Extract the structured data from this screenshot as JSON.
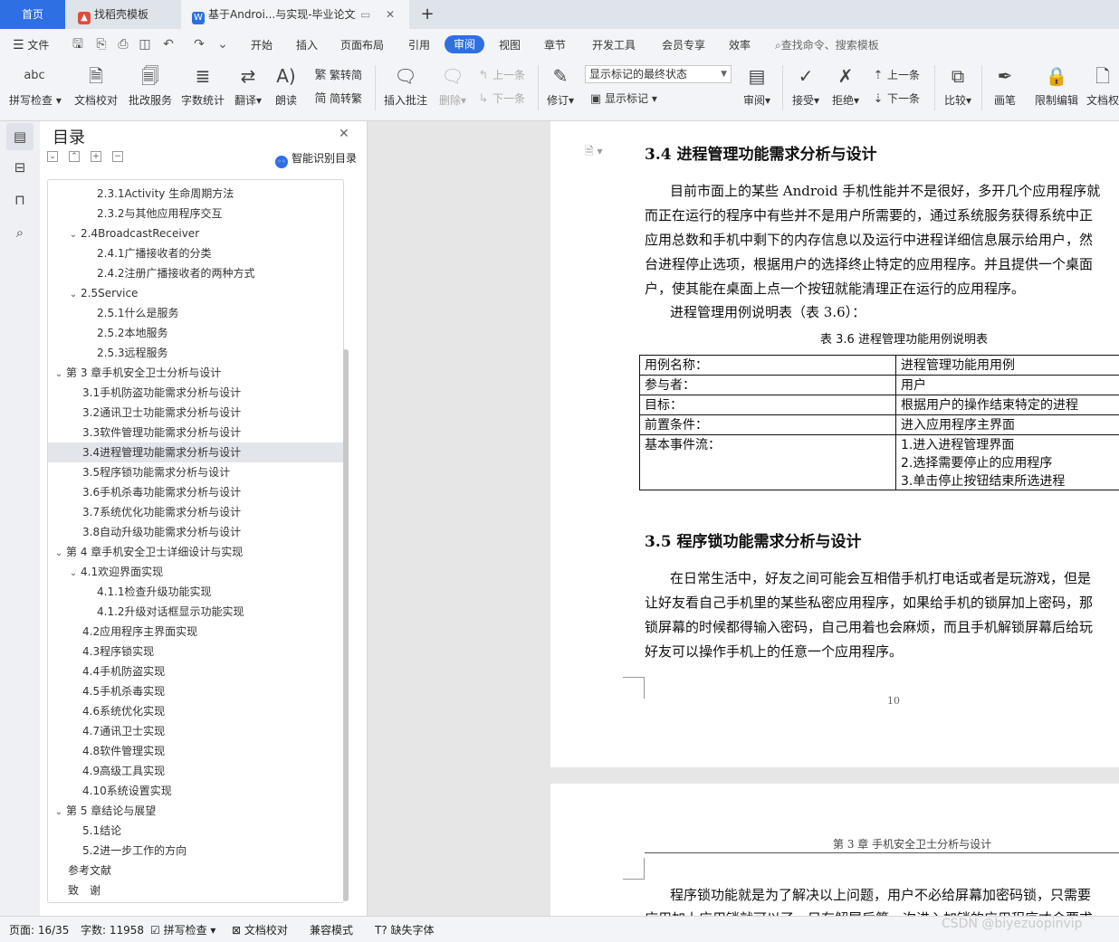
{
  "tabs": {
    "home": "首页",
    "templates": "找稻壳模板",
    "document": "基于Androi...与实现-毕业论文",
    "new_tab_icon": "plus-icon"
  },
  "menubar": {
    "file": "文件",
    "items": [
      "开始",
      "插入",
      "页面布局",
      "引用",
      "审阅",
      "视图",
      "章节",
      "开发工具",
      "会员专享",
      "效率"
    ],
    "active": "审阅",
    "search": "查找命令、搜索模板"
  },
  "ribbon": {
    "spellcheck": "拼写检查",
    "spellcheck_glyph": "abc",
    "doc_proof": "文档校对",
    "batch_service": "批改服务",
    "word_count": "字数统计",
    "translate": "翻译",
    "read_aloud": "朗读",
    "to_simplified": "繁转简",
    "to_traditional": "简转繁",
    "insert_comment": "插入批注",
    "delete": "删除",
    "prev": "上一条",
    "next": "下一条",
    "revise": "修订",
    "markup_state": "显示标记的最终状态",
    "show_markup": "显示标记",
    "review": "审阅",
    "accept": "接受",
    "reject": "拒绝",
    "prev2": "上一条",
    "next2": "下一条",
    "compare": "比较",
    "pen": "画笔",
    "restrict_edit": "限制编辑",
    "doc_rights": "文档权"
  },
  "toc": {
    "title": "目录",
    "smart": "智能识别目录",
    "selected_index": 13,
    "items": [
      {
        "text": "2.3.1Activity 生命周期方法",
        "level": 3,
        "caret": false
      },
      {
        "text": "2.3.2与其他应用程序交互",
        "level": 3,
        "caret": false
      },
      {
        "text": "2.4BroadcastReceiver",
        "level": 2,
        "caret": true
      },
      {
        "text": "2.4.1广播接收者的分类",
        "level": 3,
        "caret": false
      },
      {
        "text": "2.4.2注册广播接收者的两种方式",
        "level": 3,
        "caret": false
      },
      {
        "text": "2.5Service",
        "level": 2,
        "caret": true
      },
      {
        "text": "2.5.1什么是服务",
        "level": 3,
        "caret": false
      },
      {
        "text": "2.5.2本地服务",
        "level": 3,
        "caret": false
      },
      {
        "text": "2.5.3远程服务",
        "level": 3,
        "caret": false
      },
      {
        "text": "第 3 章手机安全卫士分析与设计",
        "level": 1,
        "caret": true
      },
      {
        "text": "3.1手机防盗功能需求分析与设计",
        "level": 2,
        "caret": false
      },
      {
        "text": "3.2通讯卫士功能需求分析与设计",
        "level": 2,
        "caret": false
      },
      {
        "text": "3.3软件管理功能需求分析与设计",
        "level": 2,
        "caret": false
      },
      {
        "text": "3.4进程管理功能需求分析与设计",
        "level": 2,
        "caret": false
      },
      {
        "text": "3.5程序锁功能需求分析与设计",
        "level": 2,
        "caret": false
      },
      {
        "text": "3.6手机杀毒功能需求分析与设计",
        "level": 2,
        "caret": false
      },
      {
        "text": "3.7系统优化功能需求分析与设计",
        "level": 2,
        "caret": false
      },
      {
        "text": "3.8自动升级功能需求分析与设计",
        "level": 2,
        "caret": false
      },
      {
        "text": "第 4 章手机安全卫士详细设计与实现",
        "level": 1,
        "caret": true
      },
      {
        "text": "4.1欢迎界面实现",
        "level": 2,
        "caret": true
      },
      {
        "text": "4.1.1检查升级功能实现",
        "level": 3,
        "caret": false
      },
      {
        "text": "4.1.2升级对话框显示功能实现",
        "level": 3,
        "caret": false
      },
      {
        "text": "4.2应用程序主界面实现",
        "level": 2,
        "caret": false
      },
      {
        "text": "4.3程序锁实现",
        "level": 2,
        "caret": false
      },
      {
        "text": "4.4手机防盗实现",
        "level": 2,
        "caret": false
      },
      {
        "text": "4.5手机杀毒实现",
        "level": 2,
        "caret": false
      },
      {
        "text": "4.6系统优化实现",
        "level": 2,
        "caret": false
      },
      {
        "text": "4.7通讯卫士实现",
        "level": 2,
        "caret": false
      },
      {
        "text": "4.8软件管理实现",
        "level": 2,
        "caret": false
      },
      {
        "text": "4.9高级工具实现",
        "level": 2,
        "caret": false
      },
      {
        "text": "4.10系统设置实现",
        "level": 2,
        "caret": false
      },
      {
        "text": "第 5 章结论与展望",
        "level": 1,
        "caret": true
      },
      {
        "text": "5.1结论",
        "level": 2,
        "caret": false
      },
      {
        "text": "5.2进一步工作的方向",
        "level": 2,
        "caret": false
      },
      {
        "text": "参考文献",
        "level": 1,
        "caret": false
      },
      {
        "text": "致　谢",
        "level": 1,
        "caret": false
      }
    ]
  },
  "doc": {
    "h34": "3.4  进程管理功能需求分析与设计",
    "p1": [
      "目前市面上的某些 Android 手机性能并不是很好，多开几个应用程序就",
      "而正在运行的程序中有些并不是用户所需要的，通过系统服务获得系统中正",
      "应用总数和手机中剩下的内存信息以及运行中进程详细信息展示给用户，然",
      "台进程停止选项，根据用户的选择终止特定的应用程序。并且提供一个桌面",
      "户，使其能在桌面上点一个按钮就能清理正在运行的应用程序。"
    ],
    "p2": "进程管理用例说明表（表 3.6）：",
    "table_caption": "表 3.6 进程管理功能用例说明表",
    "table": [
      [
        "用例名称：",
        "进程管理功能用用例"
      ],
      [
        "参与者：",
        "用户"
      ],
      [
        "目标：",
        "根据用户的操作结束特定的进程"
      ],
      [
        "前置条件：",
        "进入应用程序主界面"
      ]
    ],
    "table_flow_label": "基本事件流：",
    "table_flow": [
      "1.进入进程管理界面",
      "2.选择需要停止的应用程序",
      "3.单击停止按钮结束所选进程"
    ],
    "h35": "3.5  程序锁功能需求分析与设计",
    "p3": [
      "在日常生活中，好友之间可能会互相借手机打电话或者是玩游戏，但是",
      "让好友看自己手机里的某些私密应用程序，如果给手机的锁屏加上密码，那",
      "锁屏幕的时候都得输入密码，自己用着也会麻烦，而且手机解锁屏幕后给玩",
      "好友可以操作手机上的任意一个应用程序。"
    ],
    "page_number": "10",
    "page2_header": "第 3 章  手机安全卫士分析与设计",
    "page2_p1": "程序锁功能就是为了解决以上问题，用户不必给屏幕加密码锁，只需要",
    "page2_p2": "应用加上应用锁就可以了。只有解屏后第一次进入加锁的应用程序才会要求"
  },
  "status": {
    "page": "页面: 16/35",
    "words": "字数: 11958",
    "spell": "拼写检查",
    "proof": "文档校对",
    "compat": "兼容模式",
    "missing_font": "缺失字体"
  },
  "watermark": "CSDN @biyezuopinvip",
  "colors": {
    "accent": "#2f6fe4",
    "wps_red": "#e24b3b"
  }
}
